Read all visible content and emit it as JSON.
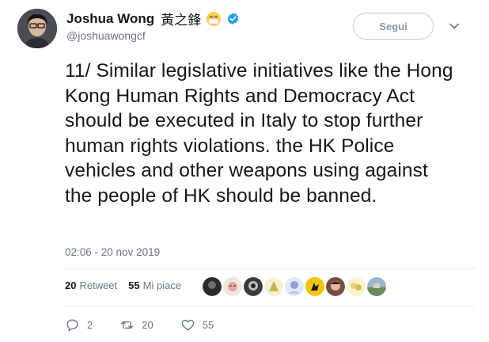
{
  "user": {
    "display_name": "Joshua Wong",
    "cjk_name": "黃之鋒",
    "handle": "@joshuawongcf",
    "verified": true
  },
  "follow_button": {
    "label": "Segui"
  },
  "tweet": {
    "text": "11/ Similar legislative initiatives like the Hong Kong Human Rights and Democracy Act should be executed in Italy to stop further human rights violations. the HK Police vehicles and other weapons using against the people of HK should be banned.",
    "timestamp": "02:06 - 20 nov 2019"
  },
  "stats": {
    "retweets_count": "20",
    "retweets_label": "Retweet",
    "likes_count": "55",
    "likes_label": "Mi piace"
  },
  "actions": {
    "replies": "2",
    "retweets": "20",
    "likes": "55"
  },
  "colors": {
    "accent": "#1da1f2",
    "secondary_text": "#657786",
    "primary_text": "#14171a"
  },
  "icons": [
    "verified-badge-icon",
    "chevron-down-icon",
    "reply-icon",
    "retweet-icon",
    "like-icon"
  ]
}
